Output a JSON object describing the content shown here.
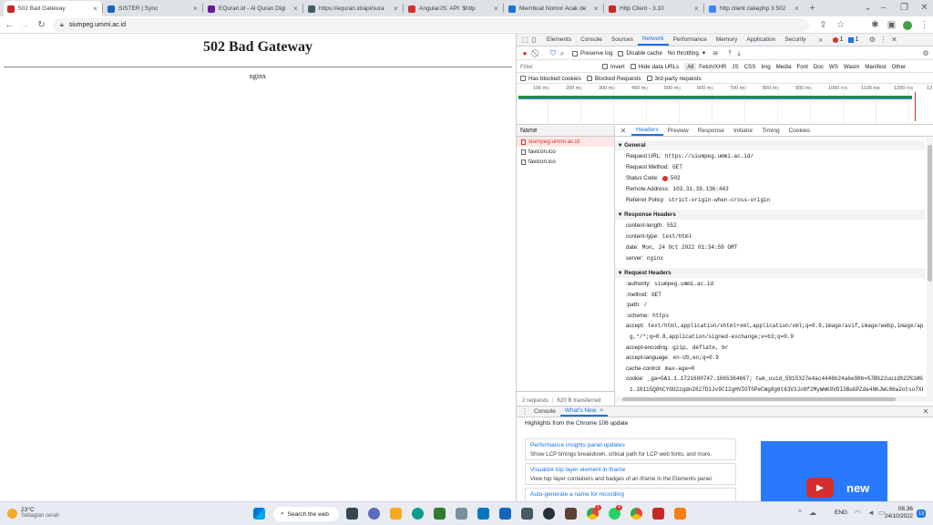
{
  "tabs": [
    {
      "title": "502 Bad Gateway",
      "color": "#c62828",
      "active": true
    },
    {
      "title": "SISTER | Sync",
      "color": "#1565c0"
    },
    {
      "title": "EQuran.id - Al Quran Digi",
      "color": "#6a1b9a"
    },
    {
      "title": "https://equran.id/api/sura",
      "color": "#455a64"
    },
    {
      "title": "AngularJS: API: $http",
      "color": "#d32f2f"
    },
    {
      "title": "Membuat Nomor Acak de",
      "color": "#1976d2"
    },
    {
      "title": "Http Client - 3.10",
      "color": "#c62828"
    },
    {
      "title": "http client cakephp 3 502",
      "color": "#4285f4"
    }
  ],
  "address": {
    "url": "siumpeg.ummi.ac.id"
  },
  "page": {
    "heading": "502 Bad Gateway",
    "server": "nginx"
  },
  "devtools": {
    "tabs": [
      "Elements",
      "Console",
      "Sources",
      "Network",
      "Performance",
      "Memory",
      "Application",
      "Security"
    ],
    "active_tab": "Network",
    "errors": "1",
    "messages": "1",
    "filter_row": {
      "preserve_log": "Preserve log",
      "disable_cache": "Disable cache",
      "throttling": "No throttling"
    },
    "filter": {
      "placeholder": "Filter",
      "invert": "Invert",
      "hide_data_urls": "Hide data URLs",
      "types": [
        "All",
        "Fetch/XHR",
        "JS",
        "CSS",
        "Img",
        "Media",
        "Font",
        "Doc",
        "WS",
        "Wasm",
        "Manifest",
        "Other"
      ]
    },
    "blocked": {
      "cookies": "Has blocked cookies",
      "requests": "Blocked Requests",
      "third_party": "3rd-party requests"
    },
    "timeline_ticks": [
      "100 ms",
      "200 ms",
      "300 ms",
      "400 ms",
      "500 ms",
      "600 ms",
      "700 ms",
      "800 ms",
      "900 ms",
      "1000 ms",
      "1100 ms",
      "1200 ms",
      "13"
    ],
    "requests": {
      "header": "Name",
      "items": [
        {
          "name": "siumpeg.ummi.ac.id",
          "error": true
        },
        {
          "name": "favicon.ico",
          "error": false
        },
        {
          "name": "favicon.ico",
          "error": false
        }
      ],
      "summary_requests": "2 requests",
      "summary_transferred": "620 B transferred"
    },
    "detail_tabs": [
      "Headers",
      "Preview",
      "Response",
      "Initiator",
      "Timing",
      "Cookies"
    ],
    "general": {
      "title": "General",
      "request_url_k": "Request URL:",
      "request_url_v": "https://siumpeg.ummi.ac.id/",
      "method_k": "Request Method:",
      "method_v": "GET",
      "status_k": "Status Code:",
      "status_v": "502",
      "remote_k": "Remote Address:",
      "remote_v": "103.31.39.136:443",
      "referrer_k": "Referrer Policy:",
      "referrer_v": "strict-origin-when-cross-origin"
    },
    "response_headers": {
      "title": "Response Headers",
      "items": [
        {
          "k": "content-length:",
          "v": "552"
        },
        {
          "k": "content-type:",
          "v": "text/html"
        },
        {
          "k": "date:",
          "v": "Mon, 24 Oct 2022 01:34:59 GMT"
        },
        {
          "k": "server:",
          "v": "nginx"
        }
      ]
    },
    "request_headers": {
      "title": "Request Headers",
      "items": [
        {
          "k": ":authority:",
          "v": "siumpeg.ummi.ac.id"
        },
        {
          "k": ":method:",
          "v": "GET"
        },
        {
          "k": ":path:",
          "v": "/"
        },
        {
          "k": ":scheme:",
          "v": "https"
        },
        {
          "k": "accept:",
          "v": "text/html,application/xhtml+xml,application/xml;q=0.9,image/avif,image/webp,image/apn"
        },
        {
          "k": "",
          "v": "g,*/*;q=0.8,application/signed-exchange;v=b3;q=0.9"
        },
        {
          "k": "accept-encoding:",
          "v": "gzip, deflate, br"
        },
        {
          "k": "accept-language:",
          "v": "en-US,en;q=0.9"
        },
        {
          "k": "cache-control:",
          "v": "max-age=0"
        },
        {
          "k": "cookie:",
          "v": "_ga=GA1.1.1721600747.1665364667; twk_uuid_5915327e4ac4446b24a6e98b=%7B%22uuid%22%3A%22"
        },
        {
          "k": "",
          "v": "1.10115Q0hCY0U2zqdn2827D1Jv9C12gHVIOTSPeCWg8g6t63V3Jo8f2MyWmK0VDI3BuGPZde48KJWc86w2otso7XKCeu"
        }
      ]
    },
    "drawer": {
      "tabs": [
        "Console",
        "What's New"
      ],
      "active": "What's New",
      "highlight": "Highlights from the Chrome 106 update",
      "items": [
        {
          "title": "Performance insights panel updates",
          "desc": "Show LCP timings breakdown, critical path for LCP web fonts, and more."
        },
        {
          "title": "Visualize top layer element in iframe",
          "desc": "View top layer containers and badges of an iframe in the Elements panel."
        },
        {
          "title": "Auto-generate a name for recording",
          "desc": ""
        }
      ],
      "video_label": "new"
    }
  },
  "taskbar": {
    "weather_temp": "23°C",
    "weather_desc": "Sebagian cerah",
    "search": "Search the web",
    "lang": "ENG",
    "time": "08.36",
    "date": "24/10/2022",
    "notif": "13",
    "badge1": "1",
    "badge2": "4"
  }
}
